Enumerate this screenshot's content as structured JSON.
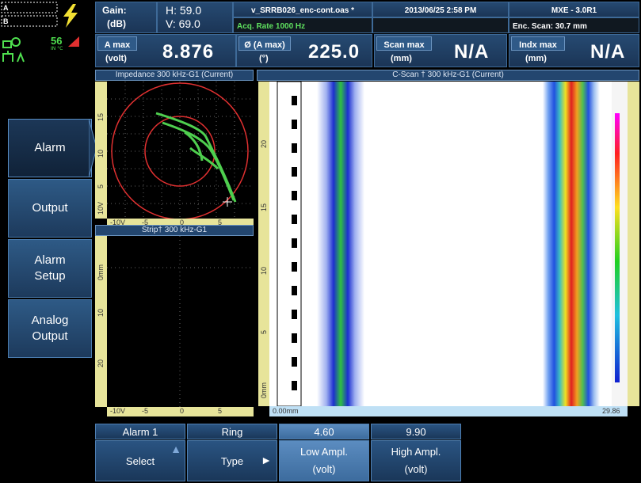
{
  "status": {
    "gain_label": "Gain:",
    "gain_unit": "(dB)",
    "gain_h": "H: 59.0",
    "gain_v": "V: 69.0",
    "filename": "v_SRRB026_enc-cont.oas *",
    "acq_rate": "Acq. Rate 1000  Hz",
    "datetime": "2013/06/25 2:58 PM",
    "version": "MXE - 3.0R1",
    "enc_scan": "Enc. Scan:  30.7 mm",
    "temp": "56",
    "temp_unit": "IN °C"
  },
  "readings": [
    {
      "label": "A max",
      "unit": "(volt)",
      "value": "8.876"
    },
    {
      "label": "Ø (A max)",
      "unit": "(°)",
      "value": "225.0"
    },
    {
      "label": "Scan max",
      "unit": "(mm)",
      "value": "N/A"
    },
    {
      "label": "Indx max",
      "unit": "(mm)",
      "value": "N/A"
    }
  ],
  "menu": {
    "items": [
      {
        "label": "Alarm",
        "active": true
      },
      {
        "label": "Output",
        "active": false
      },
      {
        "label": "Alarm\nSetup",
        "active": false
      },
      {
        "label": "Analog\nOutput",
        "active": false
      }
    ]
  },
  "panels": {
    "impedance_title": "Impedance 300 kHz-G1 (Current)",
    "strip_title": "Strip† 300 kHz-G1",
    "cscan_title": "C-Scan † 300 kHz-G1 (Current)",
    "imp_vticks": [
      "15",
      "10",
      "5",
      "10V"
    ],
    "imp_hticks": [
      "-10V",
      "-5",
      "0",
      "5"
    ],
    "strip_vticks": [
      "0mm",
      "10",
      "20"
    ],
    "strip_hticks": [
      "-10V",
      "-5",
      "0",
      "5"
    ],
    "cscan_vticks": [
      "20",
      "15",
      "10",
      "5",
      "0mm"
    ],
    "cscan_start": "0.00mm",
    "cscan_end": "29.86"
  },
  "softkeys": {
    "top": [
      "Alarm 1",
      "Ring",
      "4.60",
      "9.90"
    ],
    "bottom": [
      {
        "label": "Select",
        "arrow": "▲"
      },
      {
        "label": "Type",
        "arrow": "►"
      },
      {
        "label": "Low Ampl.\n(volt)",
        "arrow": ""
      },
      {
        "label": "High Ampl.\n(volt)",
        "arrow": ""
      }
    ]
  },
  "colors": {
    "header_bg": "#1e3c60",
    "accent": "#5fe05f",
    "lissajous": "#4fcf4f",
    "circle": "#e03030"
  }
}
